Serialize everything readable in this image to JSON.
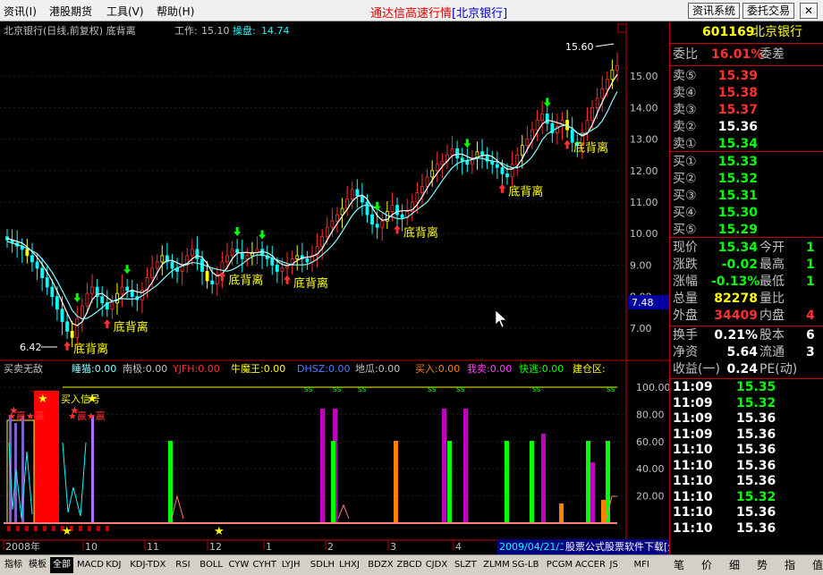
{
  "menu": [
    "资讯(I)",
    "港股期货",
    "工具(V)",
    "帮助(H)"
  ],
  "app_title": "通达信高速行情",
  "app_title_stock": "[北京银行]",
  "btn_info": "资讯系统",
  "btn_trade": "委托交易",
  "close_glyph": "✕",
  "chart_header": {
    "name": "北京银行(日线,前复权) 底背离",
    "work_label": "工作:",
    "work_value": "15.10",
    "pan_label": "操盘:",
    "pan_value": "14.74"
  },
  "price_axis": [
    "15.00",
    "14.00",
    "13.00",
    "12.00",
    "11.00",
    "10.00",
    "9.00",
    "8.00",
    "7.00"
  ],
  "cursor_price": "7.48",
  "price_high_label": "15.60",
  "price_low_label": "6.42",
  "divergence_label": "底背离",
  "indicator_header": [
    {
      "text": "买卖无敌",
      "color": "#c0c0c0"
    },
    {
      "text": "睡猫:0.00",
      "color": "#80ffff"
    },
    {
      "text": "南极:0.00",
      "color": "#c0c0c0"
    },
    {
      "text": "YJFH:0.00",
      "color": "#ff3030"
    },
    {
      "text": "牛魔王:0.00",
      "color": "#ffff00"
    },
    {
      "text": "DHSZ:0.00",
      "color": "#5080ff"
    },
    {
      "text": "地瓜:0.00",
      "color": "#c0c0c0"
    },
    {
      "text": "买入:0.00",
      "color": "#ff8000"
    },
    {
      "text": "我卖:0.00",
      "color": "#ff40ff"
    },
    {
      "text": "快逃:0.00",
      "color": "#00ff00"
    },
    {
      "text": "建仓区:",
      "color": "#ffff00"
    }
  ],
  "indicator_axis": [
    "100.00",
    "80.00",
    "60.00",
    "40.00",
    "20.00"
  ],
  "indicator_overlay_text": "买入信号",
  "indicator_win_text": "★赢★赢",
  "dates": [
    "2008年",
    "10",
    "11",
    "12",
    "1",
    "2",
    "3",
    "4"
  ],
  "status_date": "2009/04/21/二",
  "status_ad": "股票公式股票软件下载[分析家公式网www.88gs.com]",
  "quote": {
    "code": "601169",
    "name": "北京银行",
    "ratio_label": "委比",
    "ratio_value": "16.01%",
    "diff_label": "委差",
    "asks": [
      {
        "label": "卖⑤",
        "price": "15.39"
      },
      {
        "label": "卖④",
        "price": "15.38"
      },
      {
        "label": "卖③",
        "price": "15.37"
      },
      {
        "label": "卖②",
        "price": "15.36"
      },
      {
        "label": "卖①",
        "price": "15.34"
      }
    ],
    "bids": [
      {
        "label": "买①",
        "price": "15.33"
      },
      {
        "label": "买②",
        "price": "15.32"
      },
      {
        "label": "买③",
        "price": "15.31"
      },
      {
        "label": "买④",
        "price": "15.30"
      },
      {
        "label": "买⑤",
        "price": "15.29"
      }
    ],
    "stats": [
      {
        "l1": "现价",
        "v1": "15.34",
        "c1": "#00ff00",
        "l2": "今开",
        "v2": "1"
      },
      {
        "l1": "涨跌",
        "v1": "-0.02",
        "c1": "#00ff00",
        "l2": "最高",
        "v2": "1"
      },
      {
        "l1": "涨幅",
        "v1": "-0.13%",
        "c1": "#00ff00",
        "l2": "最低",
        "v2": "1"
      },
      {
        "l1": "总量",
        "v1": "82278",
        "c1": "#ffff00",
        "l2": "量比",
        "v2": ""
      },
      {
        "l1": "外盘",
        "v1": "34409",
        "c1": "#ff3030",
        "l2": "内盘",
        "v2": "4"
      }
    ],
    "stats2": [
      {
        "l1": "换手",
        "v1": "0.21%",
        "l2": "股本",
        "v2": "6"
      },
      {
        "l1": "净资",
        "v1": "5.64",
        "l2": "流通",
        "v2": "3"
      },
      {
        "l1": "收益(一)",
        "v1": "0.24",
        "l2": "PE(动)",
        "v2": ""
      }
    ],
    "ticks": [
      {
        "time": "11:09",
        "price": "15.35",
        "color": "#00ff00"
      },
      {
        "time": "11:09",
        "price": "15.32",
        "color": "#00ff00"
      },
      {
        "time": "11:09",
        "price": "15.36",
        "color": "#ffffff"
      },
      {
        "time": "11:09",
        "price": "15.36",
        "color": "#ffffff"
      },
      {
        "time": "11:10",
        "price": "15.36",
        "color": "#ffffff"
      },
      {
        "time": "11:10",
        "price": "15.36",
        "color": "#ffffff"
      },
      {
        "time": "11:10",
        "price": "15.36",
        "color": "#ffffff"
      },
      {
        "time": "11:10",
        "price": "15.32",
        "color": "#00ff00"
      },
      {
        "time": "11:10",
        "price": "15.36",
        "color": "#ffffff"
      },
      {
        "time": "11:10",
        "price": "15.36",
        "color": "#ffffff"
      }
    ]
  },
  "bottom_tabs": [
    "指标",
    "模板",
    "全部",
    "MACD",
    "KDJ",
    "KDJ-TDX",
    "RSI",
    "BOLL",
    "CYW",
    "CYHT",
    "LYJH",
    "SDLH",
    "LHXJ",
    "BDZX",
    "ZBCD",
    "CJDX",
    "SLZT",
    "ZLMM",
    "SG-LB",
    "PCGM",
    "ACCER",
    "JS",
    "MFI"
  ],
  "right_tabs": [
    "笔",
    "价",
    "细",
    "势",
    "指",
    "值"
  ],
  "chart_data": {
    "type": "candlestick",
    "title": "北京银行(日线,前复权) 底背离",
    "ylim": [
      6.2,
      16.2
    ],
    "x_ticks": [
      "2008年",
      "10",
      "11",
      "12",
      "1",
      "2",
      "3",
      "4"
    ],
    "price_high": 15.6,
    "price_low": 6.42,
    "closes": [
      9.8,
      9.7,
      9.6,
      9.5,
      9.3,
      9.1,
      8.9,
      8.6,
      8.3,
      8.0,
      7.6,
      7.2,
      6.9,
      6.7,
      7.3,
      7.7,
      8.1,
      8.3,
      8.0,
      7.8,
      7.6,
      7.8,
      8.1,
      8.3,
      8.2,
      8.0,
      7.9,
      8.2,
      8.6,
      8.9,
      9.1,
      9.3,
      9.1,
      8.9,
      8.8,
      9.0,
      9.3,
      9.5,
      9.2,
      8.8,
      8.5,
      8.4,
      8.7,
      9.1,
      9.3,
      9.5,
      9.4,
      9.2,
      9.3,
      9.4,
      9.5,
      9.3,
      9.2,
      9.0,
      8.8,
      8.9,
      9.0,
      9.2,
      9.3,
      9.2,
      9.1,
      9.3,
      9.6,
      9.9,
      10.2,
      10.4,
      10.6,
      10.8,
      11.1,
      11.4,
      11.2,
      11.0,
      10.6,
      10.3,
      10.2,
      10.4,
      10.7,
      10.9,
      10.6,
      10.5,
      10.7,
      11.0,
      11.3,
      11.5,
      11.8,
      12.0,
      12.2,
      12.3,
      12.5,
      12.7,
      12.4,
      12.3,
      12.2,
      12.4,
      12.6,
      12.5,
      12.3,
      12.2,
      12.1,
      11.9,
      11.8,
      12.2,
      12.5,
      12.8,
      13.0,
      13.3,
      13.6,
      13.8,
      13.5,
      13.2,
      13.4,
      13.6,
      13.3,
      12.9,
      12.8,
      13.2,
      13.6,
      14.0,
      14.3,
      14.6,
      14.9,
      15.2,
      15.34
    ],
    "divergence_points": [
      12,
      20,
      43,
      56,
      78,
      99,
      112
    ],
    "sell_points": [
      14,
      24,
      46,
      51,
      74,
      92,
      108
    ]
  }
}
